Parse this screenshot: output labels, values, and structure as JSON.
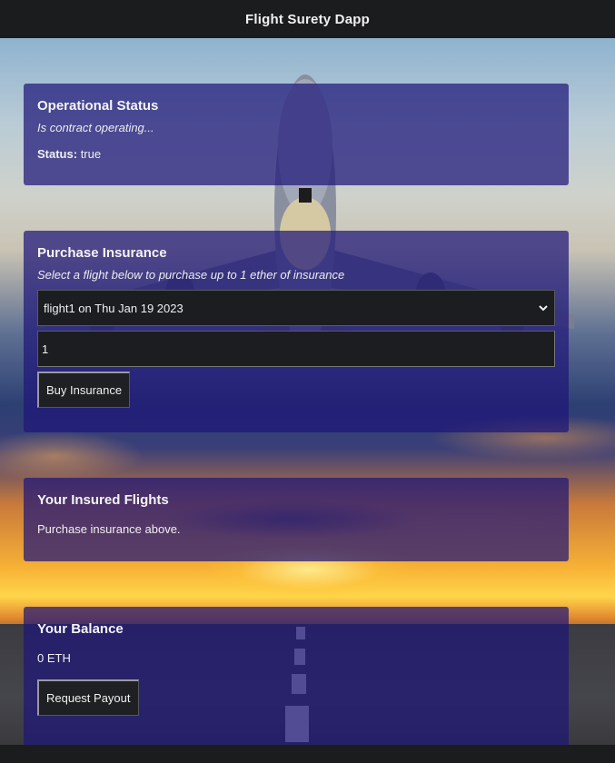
{
  "header": {
    "title": "Flight Surety Dapp"
  },
  "operational": {
    "title": "Operational Status",
    "subtitle": "Is contract operating...",
    "status_label": "Status:",
    "status_value": "true"
  },
  "purchase": {
    "title": "Purchase Insurance",
    "subtitle": "Select a flight below to purchase up to 1 ether of insurance",
    "selected_flight": "flight1 on Thu Jan 19 2023",
    "amount_value": "1",
    "buy_label": "Buy Insurance"
  },
  "insured": {
    "title": "Your Insured Flights",
    "message": "Purchase insurance above."
  },
  "balance": {
    "title": "Your Balance",
    "amount": "0 ETH",
    "payout_label": "Request Payout"
  },
  "icons": {
    "select_arrow": "chevron-down-icon"
  },
  "colors": {
    "card_bg": "#1e1678",
    "header_bg": "#1b1c1e",
    "input_bg": "#1c1d20"
  }
}
